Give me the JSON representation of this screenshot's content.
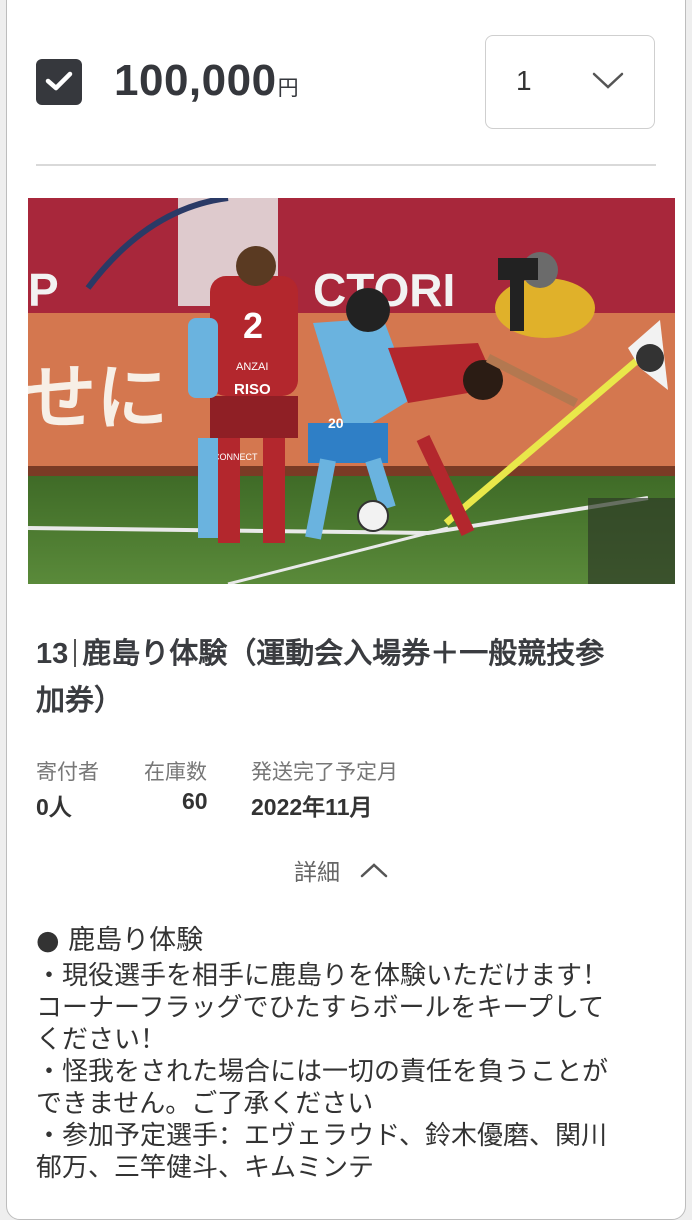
{
  "item": {
    "selected": true,
    "price": "100,000",
    "price_unit": "円",
    "quantity": "1"
  },
  "photo": {
    "banner_text_left": "P",
    "banner_text_right": "CTORI",
    "board_text": "せに",
    "jersey_number": "2",
    "jersey_name": "ANZAI",
    "sponsor": "RISO",
    "sponsor_small": "CONNECT",
    "opponent_number": "20",
    "colors": {
      "kashima_red": "#b3272d",
      "sagan_blue": "#6ab3df",
      "pitch_green": "#4d7a32",
      "board_orange": "#d67a55"
    }
  },
  "title": {
    "number": "13",
    "name": "鹿島り体験",
    "suffix_line1": "（運動会入場券＋一般競技参",
    "suffix_line2": "加券）"
  },
  "meta": {
    "donors_label": "寄付者",
    "donors_value": "0人",
    "stock_label": "在庫数",
    "stock_value": "60",
    "ship_label": "発送完了予定月",
    "ship_value": "2022年11月"
  },
  "details": {
    "toggle_label": "詳細",
    "heading": "● 鹿島り体験",
    "lines": [
      "・現役選手を相手に鹿島りを体験いただけます！",
      "コーナーフラッグでひたすらボールをキープして",
      "ください！",
      "・怪我をされた場合には一切の責任を負うことが",
      "できません。ご了承ください",
      "・参加予定選手：エヴェラウド、鈴木優磨、関川",
      "郁万、三竿健斗、キムミンテ"
    ]
  }
}
